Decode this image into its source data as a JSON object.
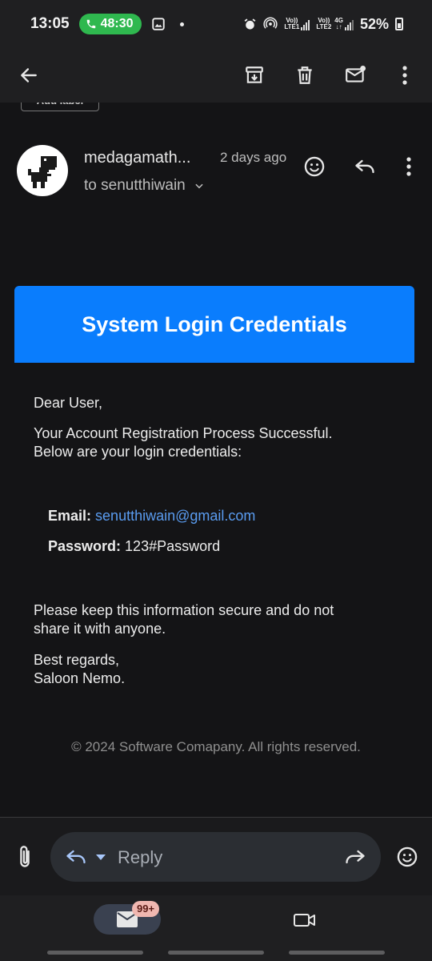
{
  "status_bar": {
    "time": "13:05",
    "call_duration": "48:30",
    "sim1_label_top": "Vo))",
    "sim1_label_bottom": "LTE1",
    "sim2_label_top": "Vo))",
    "sim2_label_bottom": "LTE2",
    "network_type": "4G",
    "battery": "52%"
  },
  "toolbar": {
    "icons": [
      "back-arrow-icon",
      "archive-icon",
      "delete-icon",
      "mark-unread-icon",
      "more-vert-icon"
    ]
  },
  "label_chip": "Add label",
  "email": {
    "sender": "medagamath...",
    "time": "2 days ago",
    "to_line": "to senutthiwain",
    "banner_title": "System Login Credentials",
    "greeting": "Dear User,",
    "intro_line1": "Your Account Registration Process Successful.",
    "intro_line2": "Below are your login credentials:",
    "email_label": "Email:",
    "email_value": "senutthiwain@gmail.com",
    "password_label": "Password:",
    "password_value": "123#Password",
    "warning_line1": "Please keep this information secure and do not",
    "warning_line2": "share it with anyone.",
    "signoff": "Best regards,",
    "signature": "Saloon Nemo.",
    "footer": "© 2024 Software Comapany. All rights reserved."
  },
  "reply_bar": {
    "placeholder": "Reply"
  },
  "bottom_nav": {
    "mail_badge": "99+"
  },
  "colors": {
    "banner": "#0a7dfd",
    "link": "#5a9cf0",
    "call_pill": "#2fb84f",
    "badge": "#f0b7b0"
  }
}
